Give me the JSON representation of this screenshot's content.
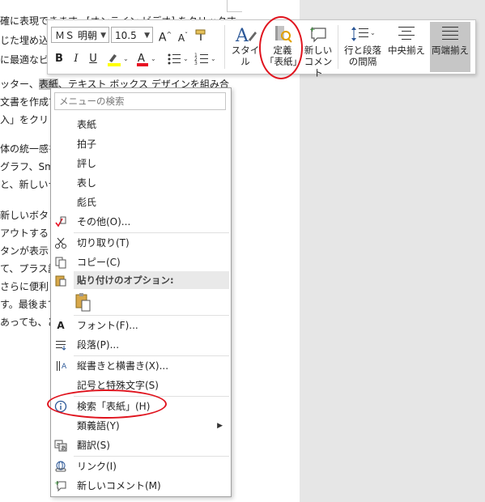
{
  "document": {
    "lines": [
      "確に表現できます。[オンライン ビデオ] をクリックす",
      "じた埋め込みコードの形式で貼り付けできるようになり",
      "に最適なビデオを検索することもできます。",
      "",
      "ッター、表紙、テキスト ボックス デザインを組み合",
      "文書を作成できます。",
      "入」をクリック",
      "",
      "体の統一感を",
      "グラフ、Smar",
      "と、新しいテ",
      "",
      "新しいボタン",
      "アウトする",
      "タンが表示",
      "て、プラス記",
      "さらに便利",
      "す。最後まで",
      "あっても、ど"
    ],
    "highlight": "表紙"
  },
  "toolbar": {
    "font_name": "ＭＳ 明朝",
    "font_size": "10.5",
    "grow_font_icon": "A",
    "shrink_font_icon": "A",
    "bold": "B",
    "italic": "I",
    "underline": "U",
    "font_color_icon": "A",
    "styles_label": "スタイル",
    "define_label_line1": "定義",
    "define_label_line2": "「表紙」",
    "new_comment_line1": "新しい",
    "new_comment_line2": "コメント",
    "line_spacing_line1": "行と段落",
    "line_spacing_line2": "の間隔",
    "center_label": "中央揃え",
    "justify_label": "両端揃え",
    "colors": {
      "highlight_yellow": "#ffff00",
      "font_red": "#e81123",
      "accent_blue": "#2b5797"
    }
  },
  "menu": {
    "search_placeholder": "メニューの検索",
    "suggestions": [
      "表紙",
      "拍子",
      "評し",
      "表し",
      "彪氏"
    ],
    "more": "その他(O)...",
    "cut": "切り取り(T)",
    "copy": "コピー(C)",
    "paste_options": "貼り付けのオプション:",
    "font": "フォント(F)...",
    "paragraph": "段落(P)...",
    "text_direction": "縦書きと横書き(X)...",
    "symbols": "記号と特殊文字(S)",
    "search": "検索「表紙」(H)",
    "thesaurus": "類義語(Y)",
    "translate": "翻訳(S)",
    "link": "リンク(I)",
    "new_comment": "新しいコメント(M)"
  },
  "annotation_color": "#e0141e"
}
